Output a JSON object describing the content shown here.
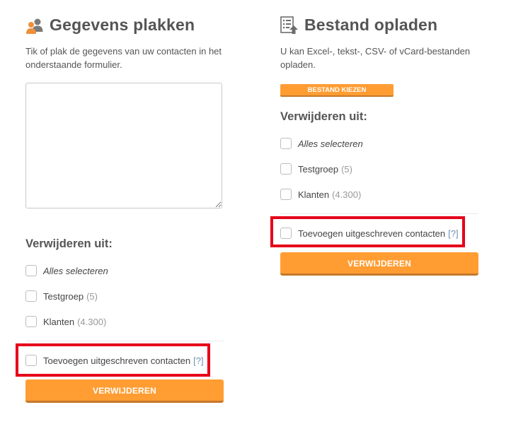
{
  "left": {
    "title": "Gegevens plakken",
    "title_icon": "contacts-icon",
    "description": "Tik of plak de gegevens van uw contacten in het onderstaande formulier.",
    "textarea_value": "",
    "remove_from_heading": "Verwijderen uit:",
    "select_all_label": "Alles selecteren",
    "groups": [
      {
        "name": "Testgroep",
        "count": "(5)"
      },
      {
        "name": "Klanten",
        "count": "(4.300)"
      }
    ],
    "add_unsubscribed_label": "Toevoegen uitgeschreven contacten",
    "help_label": "[?]",
    "submit_label": "VERWIJDEREN"
  },
  "right": {
    "title": "Bestand opladen",
    "title_icon": "file-upload-icon",
    "description": "U kan Excel-, tekst-, CSV- of vCard-bestanden opladen.",
    "choose_file_label": "BESTAND KIEZEN",
    "remove_from_heading": "Verwijderen uit:",
    "select_all_label": "Alles selecteren",
    "groups": [
      {
        "name": "Testgroep",
        "count": "(5)"
      },
      {
        "name": "Klanten",
        "count": "(4.300)"
      }
    ],
    "add_unsubscribed_label": "Toevoegen uitgeschreven contacten",
    "help_label": "[?]",
    "submit_label": "VERWIJDEREN"
  },
  "colors": {
    "accent": "#ff9d33",
    "highlight": "#e6001a",
    "help_link": "#6f8fb3"
  }
}
